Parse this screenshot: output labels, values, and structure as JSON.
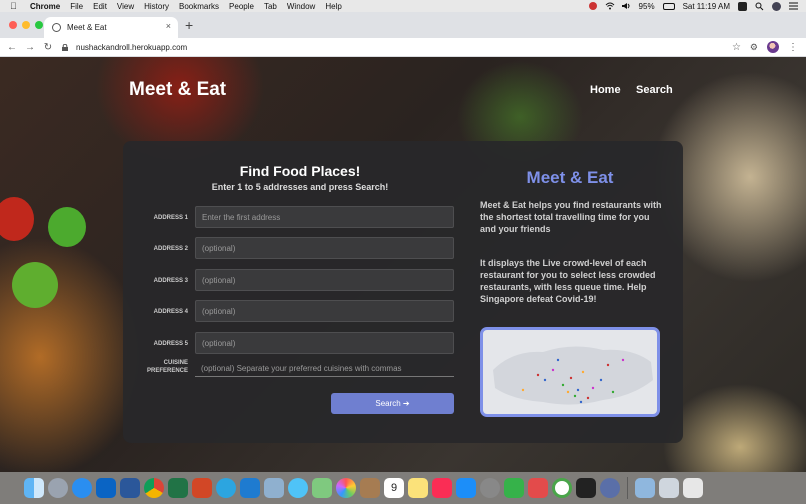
{
  "menubar": {
    "app_name": "Chrome",
    "menus": [
      "File",
      "Edit",
      "View",
      "History",
      "Bookmarks",
      "People",
      "Tab",
      "Window",
      "Help"
    ],
    "battery": "95%",
    "clock": "Sat 11:19 AM"
  },
  "tab": {
    "title": "Meet & Eat",
    "close": "×",
    "new_tab": "+"
  },
  "toolbar": {
    "url": "nushackandroll.herokuapp.com"
  },
  "site": {
    "brand": "Meet & Eat",
    "nav": {
      "home": "Home",
      "search": "Search"
    }
  },
  "form": {
    "title": "Find Food Places!",
    "subtitle": "Enter 1 to 5 addresses and press Search!",
    "fields": [
      {
        "label": "ADDRESS 1",
        "placeholder": "Enter the first address"
      },
      {
        "label": "ADDRESS 2",
        "placeholder": "(optional)"
      },
      {
        "label": "ADDRESS 3",
        "placeholder": "(optional)"
      },
      {
        "label": "ADDRESS 4",
        "placeholder": "(optional)"
      },
      {
        "label": "ADDRESS 5",
        "placeholder": "(optional)"
      }
    ],
    "cuisine": {
      "label_line1": "CUISINE",
      "label_line2": "PREFERENCE",
      "placeholder": "(optional) Separate your preferred cuisines with commas"
    },
    "search_button": "Search ➔"
  },
  "about": {
    "title": "Meet & Eat",
    "paragraph1": "Meet & Eat helps you find restaurants with the shortest total travelling time for you and your friends",
    "paragraph2": "It displays the Live crowd-level of each restaurant for you to select less crowded restaurants, with less queue time. Help Singapore defeat Covid-19!"
  },
  "colors": {
    "accent": "#7e90e8",
    "button": "#6f7fd0",
    "card": "#28282a"
  },
  "dock": {
    "apps": [
      "finder-icon",
      "launchpad-icon",
      "safari-icon",
      "outlook-icon",
      "word-icon",
      "chrome-icon",
      "excel-icon",
      "powerpoint-icon",
      "telegram-icon",
      "vscode-icon",
      "preview-icon",
      "messages-icon",
      "maps-icon",
      "photos-icon",
      "notes-icon",
      "calendar-icon",
      "notes-yellow-icon",
      "music-icon",
      "appstore-icon",
      "system-preferences-icon",
      "numbers-icon",
      "gift-icon",
      "circle-icon",
      "terminal-icon",
      "activity-icon",
      "folder-icon",
      "downloads-icon",
      "trash-icon"
    ],
    "calendar_day": "9"
  }
}
